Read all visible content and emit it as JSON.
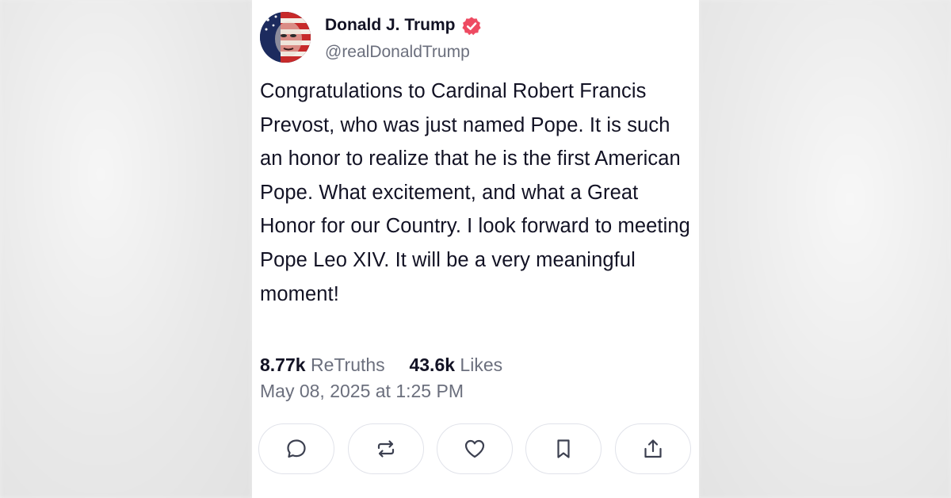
{
  "post": {
    "author_name": "Donald J. Trump",
    "handle": "@realDonaldTrump",
    "verified": true,
    "text": "Congratulations to Cardinal Robert Francis Prevost, who was just named Pope. It is such an honor to realize that he is the first American Pope. What excitement, and what a Great Honor for our Country. I look forward to meeting Pope Leo XIV. It will be a very meaningful moment!",
    "retruths_count": "8.77k",
    "retruths_label": "ReTruths",
    "likes_count": "43.6k",
    "likes_label": "Likes",
    "timestamp": "May 08, 2025 at 1:25 PM"
  },
  "actions": [
    {
      "name": "reply",
      "icon": "comment-icon"
    },
    {
      "name": "retruth",
      "icon": "repost-icon"
    },
    {
      "name": "like",
      "icon": "heart-icon"
    },
    {
      "name": "bookmark",
      "icon": "bookmark-icon"
    },
    {
      "name": "share",
      "icon": "share-icon"
    }
  ],
  "colors": {
    "text_primary": "#121224",
    "text_secondary": "#6b6f7d",
    "verified_badge": "#ee4b62",
    "button_border": "#e1e3ea"
  }
}
